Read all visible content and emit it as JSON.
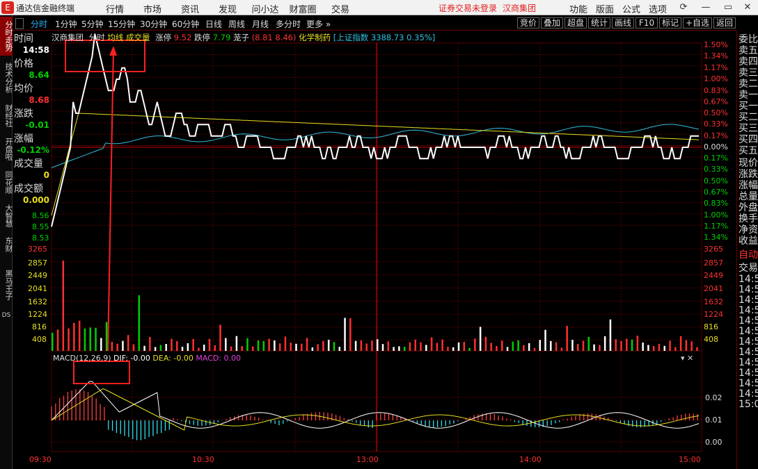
{
  "app": {
    "logo": "E",
    "title": "通达信金融终端",
    "menus": [
      "行情",
      "市场",
      "资讯",
      "发现",
      "问小达",
      "财富圈",
      "交易"
    ],
    "notice": "证券交易未登录",
    "stock_name": "汉商集团",
    "right_menus": [
      "功能",
      "版面",
      "公式",
      "选项"
    ]
  },
  "left_tabs": [
    "分时走势",
    "技术分析",
    "财经社",
    "开盘啦",
    "同花顺",
    "大智慧",
    "东财",
    "黑马王子",
    "DS"
  ],
  "period_bar": {
    "items": [
      "分时",
      "1分钟",
      "5分钟",
      "15分钟",
      "30分钟",
      "60分钟",
      "日线",
      "周线",
      "月线",
      "多分时",
      "更多"
    ],
    "active": "分时",
    "tools": [
      "竞价",
      "叠加",
      "超盘",
      "统计",
      "画线",
      "F10",
      "标记",
      "+自选",
      "返回"
    ]
  },
  "legend": {
    "name": "汉商集团",
    "period": "分时",
    "avg": "均线",
    "vol": "成交量",
    "zt_label": "涨停",
    "zt": "9.52",
    "dt_label": "跌停",
    "dt": "7.79",
    "maozi": "茏子",
    "maozi_vals": "(8.81 8.46)",
    "sector": "化学制药",
    "index_name": "上证指数",
    "index_val": "3388.73",
    "index_pct": "0.35%"
  },
  "info": {
    "time_label": "时间",
    "time": "14:58",
    "price_label": "价格",
    "price": "8.64",
    "avg_label": "均价",
    "avg": "8.68",
    "chg_label": "涨跌",
    "chg": "-0.01",
    "pct_label": "涨幅",
    "pct": "-0.12%",
    "vol_label": "成交量",
    "vol": "0",
    "amt_label": "成交额",
    "amt": "0.000"
  },
  "left_price_ticks": [
    "8.56",
    "8.55",
    "8.53"
  ],
  "left_vol_ticks": [
    "3265",
    "2857",
    "2449",
    "2041",
    "1632",
    "1224",
    "816",
    "408"
  ],
  "right_pct_up": [
    "1.50%",
    "1.34%",
    "1.17%",
    "1.00%",
    "0.83%",
    "0.67%",
    "0.50%",
    "0.33%",
    "0.17%"
  ],
  "right_pct_mid": "0.00%",
  "right_pct_down": [
    "0.17%",
    "0.33%",
    "0.50%",
    "0.67%",
    "0.83%",
    "1.00%",
    "1.17%",
    "1.34%"
  ],
  "right_vol_ticks": [
    "3265",
    "2857",
    "2449",
    "2041",
    "1632",
    "1224",
    "816",
    "408"
  ],
  "macd": {
    "title": "MACD(12,26,9)",
    "dif": "DIF: -0.00",
    "dea": "DEA: -0.00",
    "macd": "MACD: 0.00",
    "ticks": [
      "0.02",
      "0.01",
      "0.00"
    ]
  },
  "time_axis": [
    "09:30",
    "10:30",
    "13:00",
    "14:00",
    "15:00"
  ],
  "right_panel": [
    "委比",
    "卖五",
    "卖四",
    "卖三",
    "卖二",
    "卖一",
    "买一",
    "买二",
    "买三",
    "买四",
    "买五",
    "现价",
    "涨跌",
    "涨幅",
    "总量",
    "外盘",
    "换手",
    "净资",
    "收益",
    "自动",
    "交易",
    "14:5",
    "14:5",
    "14:5",
    "14:5",
    "14:5",
    "14:5",
    "14:5",
    "14:5",
    "14:5",
    "14:5",
    "14:5",
    "14:5",
    "15:0"
  ],
  "colors": {
    "up": "#ff3030",
    "down": "#00d000",
    "price": "#ffffff",
    "avg": "#e8e020",
    "cyan": "#30c0e0",
    "grid": "#5a0000",
    "accent": "#2ab4ff"
  }
}
